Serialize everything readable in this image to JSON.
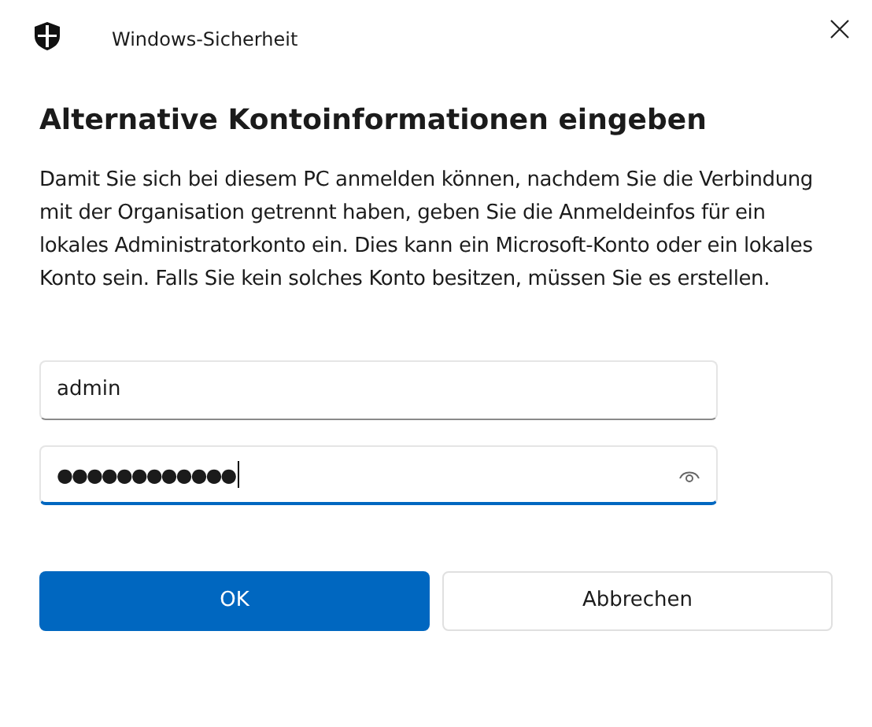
{
  "window": {
    "title": "Windows-Sicherheit"
  },
  "heading": "Alternative Kontoinformationen eingeben",
  "description": "Damit Sie sich bei diesem PC anmelden können, nachdem Sie die Verbindung mit der Organisation getrennt haben, geben Sie die Anmeldeinfos für ein lokales Administratorkonto ein. Dies kann ein Microsoft-Konto oder ein lokales Konto sein. Falls Sie kein solches Konto besitzen, müssen Sie es erstellen.",
  "fields": [
    {
      "kind": "text",
      "value": "admin",
      "focused": false
    },
    {
      "kind": "password",
      "value": "●●●●●●●●●●●●",
      "focused": true
    }
  ],
  "buttons": [
    {
      "label": "OK",
      "kind": "primary"
    },
    {
      "label": "Abbrechen",
      "kind": "secondary"
    }
  ]
}
